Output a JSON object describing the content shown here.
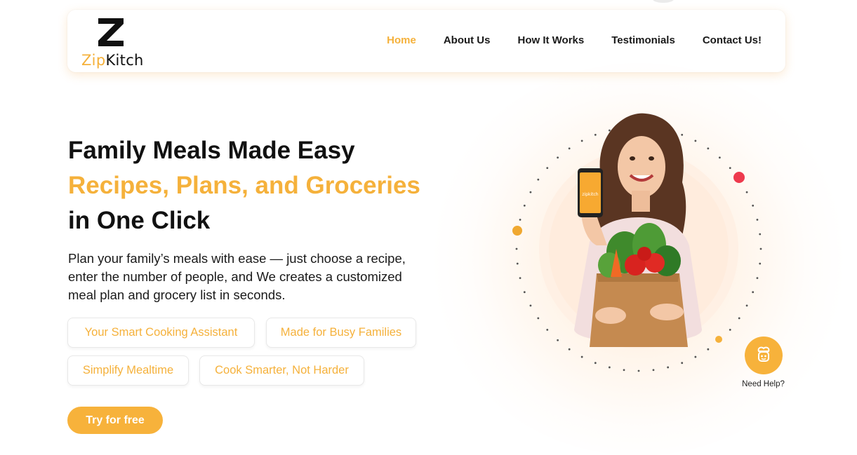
{
  "brand": {
    "logo_zip": "Zip",
    "logo_kitch": "Kitch",
    "accent_color": "#f5b13b",
    "alert_color": "#ee3a4d"
  },
  "nav": {
    "items": [
      {
        "label": "Home",
        "active": true
      },
      {
        "label": "About Us",
        "active": false
      },
      {
        "label": "How It Works",
        "active": false
      },
      {
        "label": "Testimonials",
        "active": false
      },
      {
        "label": "Contact Us!",
        "active": false
      }
    ]
  },
  "hero": {
    "title_line1": "Family Meals Made Easy",
    "title_line2": "Recipes, Plans, and Groceries",
    "title_line3": "in One Click",
    "description": "Plan your family’s meals with ease — just choose a recipe, enter the number of people, and We creates a customized meal plan and grocery list in seconds.",
    "chips": [
      "Your Smart Cooking Assistant",
      "Made for Busy Families",
      "Simplify Mealtime",
      "Cook Smarter, Not Harder"
    ],
    "cta_label": "Try for free"
  },
  "visual": {
    "phone_app_text": "zipkitch",
    "icons": [
      "woman-holding-phone-and-grocery-bag",
      "chef-robot-icon"
    ]
  },
  "help": {
    "label": "Need Help?"
  }
}
